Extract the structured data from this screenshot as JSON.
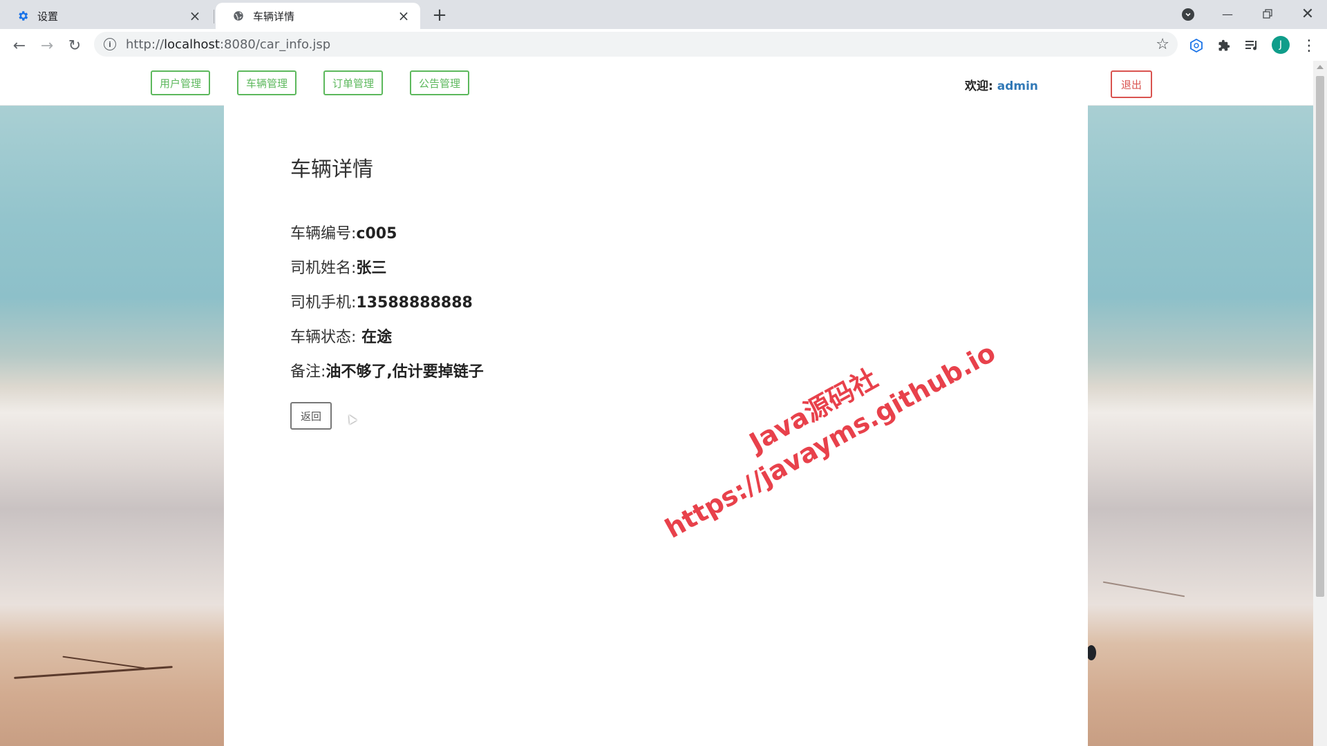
{
  "browser": {
    "tabs": [
      {
        "title": "设置",
        "icon": "gear-icon",
        "active": false
      },
      {
        "title": "车辆详情",
        "icon": "globe-icon",
        "active": true
      }
    ],
    "url_prefix": "http://",
    "url_host": "localhost",
    "url_rest": ":8080/car_info.jsp",
    "profile_initial": "J"
  },
  "header": {
    "nav": [
      "用户管理",
      "车辆管理",
      "订单管理",
      "公告管理"
    ],
    "welcome_label": "欢迎:",
    "username": "admin",
    "logout_label": "退出"
  },
  "main": {
    "title": "车辆详情",
    "fields": [
      {
        "label": "车辆编号:",
        "value": "c005"
      },
      {
        "label": "司机姓名:",
        "value": "张三"
      },
      {
        "label": "司机手机:",
        "value": "13588888888"
      },
      {
        "label": "车辆状态:",
        "value": " 在途"
      },
      {
        "label": "备注:",
        "value": "油不够了,估计要掉链子"
      }
    ],
    "back_label": "返回"
  },
  "watermark": {
    "line1": "Java源码社",
    "line2": "https://javayms.github.io"
  },
  "colors": {
    "success": "#5cb85c",
    "danger": "#d9534f",
    "link": "#337ab7",
    "watermark": "#e8414b"
  }
}
